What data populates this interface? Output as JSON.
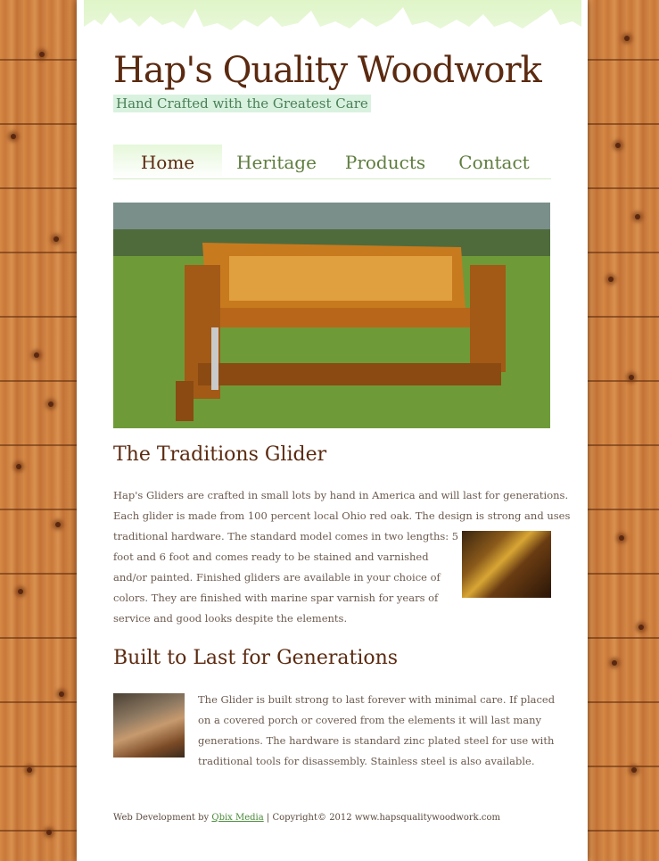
{
  "site": {
    "title": "Hap's Quality Woodwork",
    "tagline": "Hand Crafted with the Greatest Care"
  },
  "nav": {
    "items": [
      {
        "label": "Home",
        "active": true
      },
      {
        "label": "Heritage",
        "active": false
      },
      {
        "label": "Products",
        "active": false
      },
      {
        "label": "Contact",
        "active": false
      }
    ]
  },
  "hero": {
    "subject": "wooden glider bench on grass"
  },
  "section1": {
    "heading": "The Traditions Glider",
    "lines": [
      "Hap's Gliders are crafted in small lots by hand in America and will last for generations.",
      "Each glider is made from 100 percent local Ohio red oak. The design is strong and uses",
      "traditional hardware. The standard model comes in two lengths: 5",
      "foot and 6 foot and comes ready to be stained and varnished",
      "and/or painted. Finished gliders are available in your choice of",
      "colors. They are finished with marine spar varnish for years of",
      "service and good looks despite the elements."
    ]
  },
  "section2": {
    "heading": "Built to Last for Generations",
    "lines": [
      "The Glider is built strong to last forever with minimal care. If placed",
      "on a covered porch or covered from the elements it will last many",
      "generations. The hardware is standard zinc plated steel for use with",
      "traditional tools for disassembly. Stainless steel is also available."
    ]
  },
  "footer": {
    "prefix": "Web Development by",
    "link": "Qbix Media",
    "suffix": "| Copyright© 2012 www.hapsqualitywoodwork.com"
  },
  "colors": {
    "title": "#5b2a10",
    "nav": "#5e7d3e",
    "tagline_bg": "#d9f2e0",
    "wood": "#cd803e"
  }
}
